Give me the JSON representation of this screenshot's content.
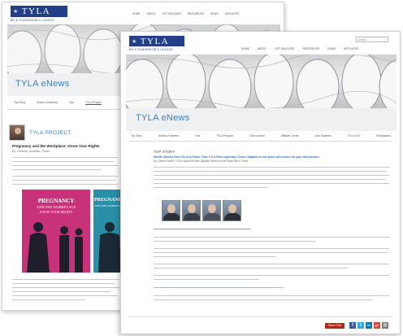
{
  "back_page": {
    "logo": {
      "word": "TYLA",
      "sub": "BE A TOMORROW'S LEADER"
    },
    "top_nav": [
      "HOME",
      "ABOUT",
      "GET INVOLVED",
      "RESOURCES",
      "NEWS",
      "AFFILIATES"
    ],
    "enews_title": "TYLA eNews",
    "tabs": [
      "Top Story",
      "Article of Interest",
      "Tips",
      "TYLA Project"
    ],
    "profile_title": "TYLA PROJECT",
    "article_title": "Pregnancy and the Workplace: Know Your Rights",
    "article_byline": "By: Courtney Gonzales, Texas",
    "book1_text": [
      "PREGNANCY",
      "AND THE WORKPLACE",
      "KNOW YOUR RIGHTS"
    ],
    "book2_text": [
      "PREGNANCY",
      "AND THE WORKPLACE"
    ]
  },
  "front_page": {
    "logo": {
      "word": "TYLA",
      "sub": "BE A TOMORROW'S LEADER"
    },
    "search_placeholder": "Search",
    "top_nav": [
      "HOME",
      "ABOUT",
      "GET INVOLVED",
      "RESOURCES",
      "NEWS",
      "AFFILIATES"
    ],
    "enews_title": "TYLA eNews",
    "sections": [
      "Top Story",
      "Article of Interest",
      "Tips",
      "TYLA Projects",
      "Get Involved",
      "Affiliate Corner",
      "Law Students",
      "TYLA CLE",
      "Publications"
    ],
    "top_story_label": "TOP STORY",
    "story_headline": "Pat Mc Sharley Don't Go Any Faster Than TYLA Past Legendary Texas Litigators in one place with advice for your trial practice",
    "story_byline": "By: Daniel Hunter, TYLA Liaison for the Litigation Section of the State Bar of Texas",
    "share_label": "Share This",
    "social_icons": [
      {
        "name": "facebook",
        "glyph": "f",
        "color": "#3b5998"
      },
      {
        "name": "twitter",
        "glyph": "t",
        "color": "#33a8e0"
      },
      {
        "name": "linkedin",
        "glyph": "in",
        "color": "#0e76a8"
      },
      {
        "name": "google",
        "glyph": "g+",
        "color": "#d34836"
      },
      {
        "name": "email",
        "glyph": "@",
        "color": "#7d7d7d"
      }
    ]
  },
  "colors": {
    "brand": "#233f86",
    "accent": "#3b7fc0",
    "share": "#b5271d"
  }
}
